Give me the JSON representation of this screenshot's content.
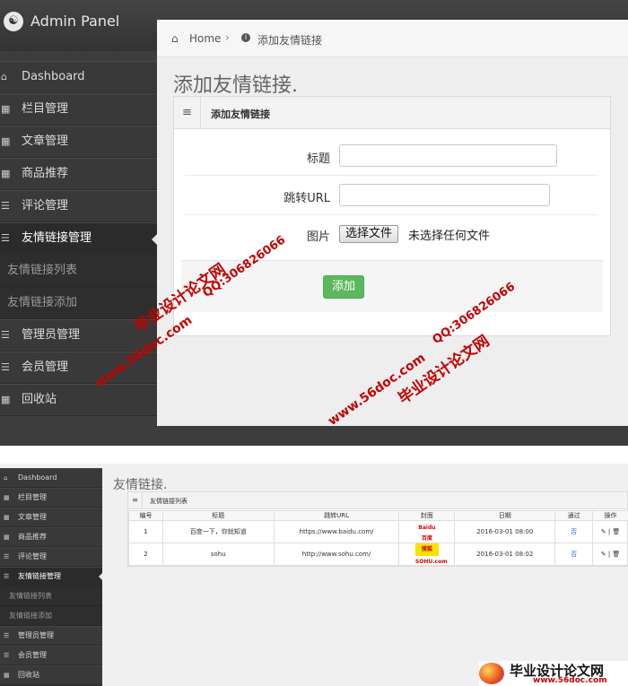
{
  "top": {
    "brand": "Admin Panel",
    "sidebar": {
      "items": [
        {
          "label": "Dashboard",
          "icon": "home-icon"
        },
        {
          "label": "栏目管理",
          "icon": "grid-icon"
        },
        {
          "label": "文章管理",
          "icon": "grid-icon"
        },
        {
          "label": "商品推荐",
          "icon": "grid-icon"
        },
        {
          "label": "评论管理",
          "icon": "list-icon"
        },
        {
          "label": "友情链接管理",
          "icon": "list-icon",
          "active": true
        }
      ],
      "subitems": [
        "友情链接列表",
        "友情链接添加"
      ],
      "items_after": [
        {
          "label": "管理员管理",
          "icon": "list-icon"
        },
        {
          "label": "会员管理",
          "icon": "list-icon"
        },
        {
          "label": "回收站",
          "icon": "grid-icon"
        }
      ]
    },
    "breadcrumb": {
      "home": "Home",
      "current": "添加友情链接"
    },
    "page_title": "添加友情链接.",
    "panel_title": "添加友情链接",
    "form": {
      "title_label": "标题",
      "url_label": "跳转URL",
      "image_label": "图片",
      "file_button": "选择文件",
      "file_status": "未选择任何文件",
      "submit": "添加"
    }
  },
  "bottom": {
    "sidebar": {
      "items": [
        {
          "label": "Dashboard"
        },
        {
          "label": "栏目管理"
        },
        {
          "label": "文章管理"
        },
        {
          "label": "商品推荐"
        },
        {
          "label": "评论管理"
        },
        {
          "label": "友情链接管理"
        }
      ],
      "subitems": [
        "友情链接列表",
        "友情链接添加"
      ],
      "items_after": [
        {
          "label": "管理员管理"
        },
        {
          "label": "会员管理"
        },
        {
          "label": "回收站"
        }
      ]
    },
    "page_title": "友情链接.",
    "panel_title": "友情链接列表",
    "table": {
      "headers": [
        "编号",
        "标题",
        "跳转URL",
        "封面",
        "日期",
        "通过",
        "操作"
      ],
      "rows": [
        {
          "id": "1",
          "title": "百度一下，你就知道",
          "url": "https://www.baidu.com/",
          "cover": "Baidu百度",
          "date": "2016-03-01 08:00",
          "approved": "否",
          "ops": "✎ | 🗑"
        },
        {
          "id": "2",
          "title": "sohu",
          "url": "http://www.sohu.com/",
          "cover": "搜狐 SOHU.com",
          "date": "2016-03-01 08:02",
          "approved": "否",
          "ops": "✎ | 🗑"
        }
      ]
    }
  },
  "watermarks": {
    "site_name": "毕业设计论文网",
    "domain": "www.56doc.com",
    "qq": "QQ:306826066"
  }
}
